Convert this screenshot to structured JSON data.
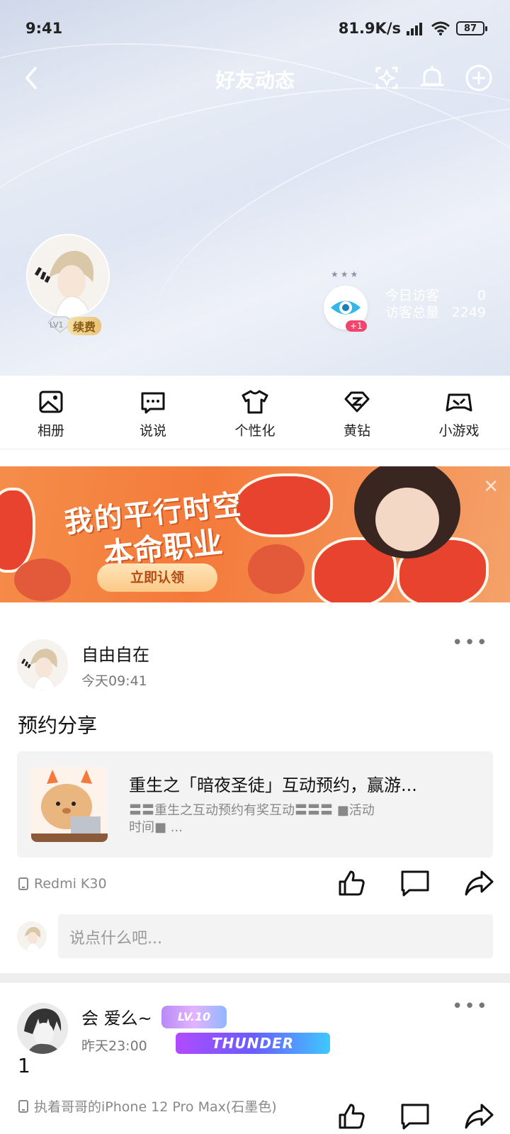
{
  "status_bar": {
    "time": "9:41",
    "speed": "81.9K/s",
    "battery": "87"
  },
  "nav": {
    "title": "好友动态"
  },
  "profile": {
    "level": "LV1",
    "renew_label": "续费",
    "plus_badge": "+1",
    "visitors": {
      "today_label": "今日访客",
      "today_value": "0",
      "total_label": "访客总量",
      "total_value": "2249"
    }
  },
  "quick_menu": [
    {
      "label": "相册",
      "icon": "photo-album-icon"
    },
    {
      "label": "说说",
      "icon": "chat-bubble-icon"
    },
    {
      "label": "个性化",
      "icon": "tshirt-icon"
    },
    {
      "label": "黄钻",
      "icon": "diamond-icon"
    },
    {
      "label": "小游戏",
      "icon": "gamepad-icon"
    }
  ],
  "banner": {
    "line1": "我的平行时空",
    "line2": "本命职业",
    "button": "立即认领"
  },
  "posts": [
    {
      "author": "自由自在",
      "time": "今天09:41",
      "text": "预约分享",
      "card": {
        "title": "重生之「暗夜圣徒」互动预约，赢游...",
        "desc": "〓〓重生之互动预约有奖互动〓〓〓 ■活动时间■  ..."
      },
      "device": "Redmi K30",
      "comment_placeholder": "说点什么吧..."
    },
    {
      "author": "会 爱么~",
      "time": "昨天23:00",
      "text": "1",
      "badges": {
        "level": "LV.10",
        "thunder": "THUNDER"
      },
      "device": "执着哥哥的iPhone 12 Pro Max(石墨色)"
    }
  ],
  "colors": {
    "accent_pink": "#f0466e",
    "banner_orange": "#f47a3a"
  }
}
